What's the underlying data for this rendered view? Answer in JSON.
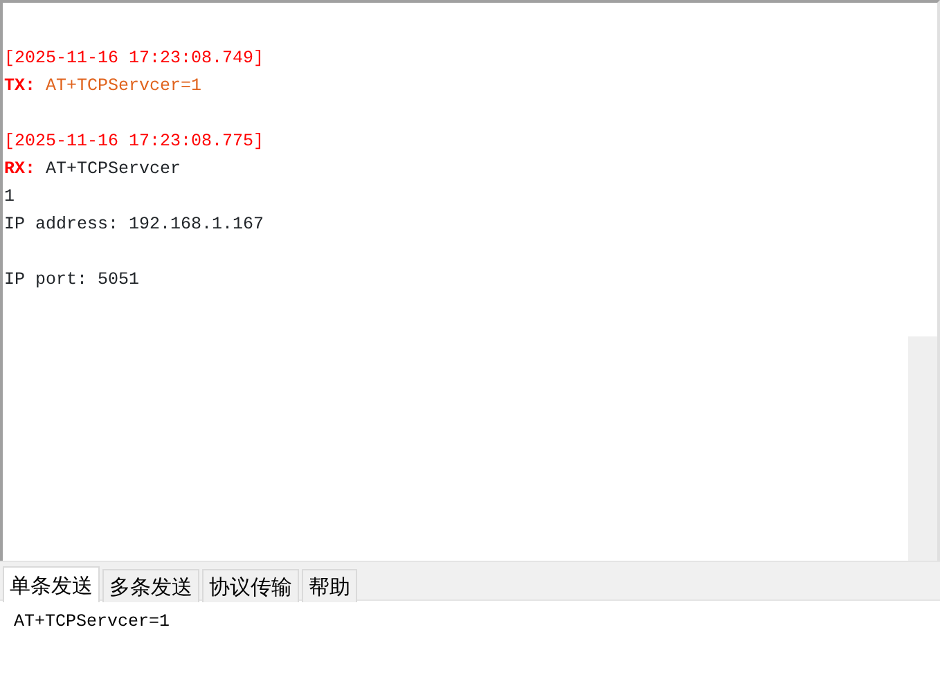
{
  "log": [
    {
      "kind": "blank"
    },
    {
      "kind": "timestamp",
      "text": "[2025-11-16 17:23:08.749]"
    },
    {
      "kind": "tx",
      "prefix": "TX:",
      "text": "AT+TCPServcer=1"
    },
    {
      "kind": "blank"
    },
    {
      "kind": "timestamp",
      "text": "[2025-11-16 17:23:08.775]"
    },
    {
      "kind": "rx",
      "prefix": "RX:",
      "text": "AT+TCPServcer"
    },
    {
      "kind": "text",
      "text": "1"
    },
    {
      "kind": "text",
      "text": "IP address: 192.168.1.167"
    },
    {
      "kind": "blank"
    },
    {
      "kind": "text",
      "text": "IP port: 5051"
    }
  ],
  "tabs": [
    {
      "label": "单条发送",
      "selected": true
    },
    {
      "label": "多条发送",
      "selected": false
    },
    {
      "label": "协议传输",
      "selected": false
    },
    {
      "label": "帮助",
      "selected": false
    }
  ],
  "send_input": {
    "value": "AT+TCPServcer=1"
  }
}
